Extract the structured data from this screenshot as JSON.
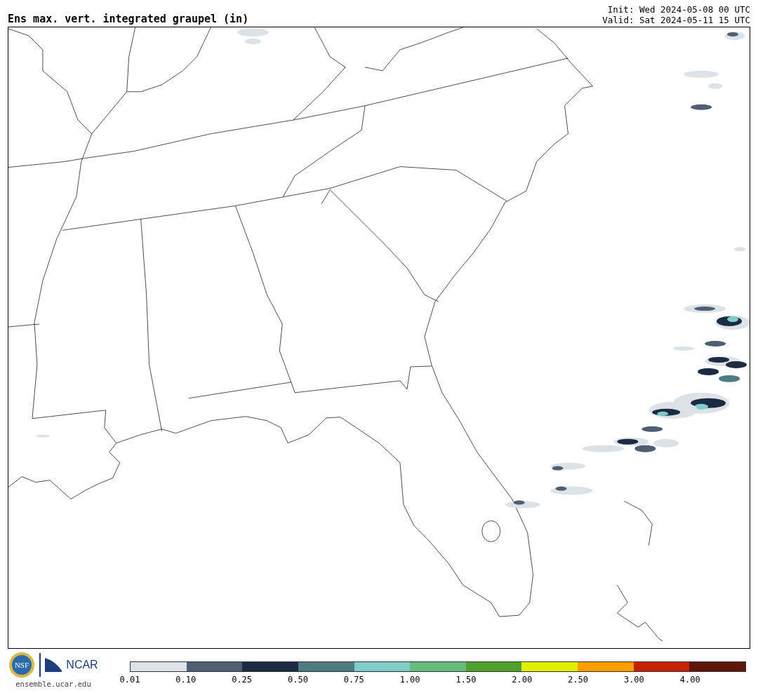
{
  "title": "Ens max. vert. integrated graupel (in)",
  "init": "Init: Wed 2024-05-08 00 UTC",
  "valid": "Valid: Sat 2024-05-11 15 UTC",
  "logos": {
    "nsf": "NSF",
    "ncar": "NCAR",
    "site": "ensemble.ucar.edu"
  },
  "colorbar": [
    {
      "label": "0.01",
      "color": "#dde2e6"
    },
    {
      "label": "0.10",
      "color": "#4f5e72"
    },
    {
      "label": "0.25",
      "color": "#1a2b42"
    },
    {
      "label": "0.50",
      "color": "#4a7c82"
    },
    {
      "label": "0.75",
      "color": "#7fcdc8"
    },
    {
      "label": "1.00",
      "color": "#66bb7e"
    },
    {
      "label": "1.50",
      "color": "#4ea22a"
    },
    {
      "label": "2.00",
      "color": "#e0f000"
    },
    {
      "label": "2.50",
      "color": "#ff9f00"
    },
    {
      "label": "3.00",
      "color": "#c62400"
    },
    {
      "label": "4.00",
      "color": "#5f160b"
    }
  ]
}
